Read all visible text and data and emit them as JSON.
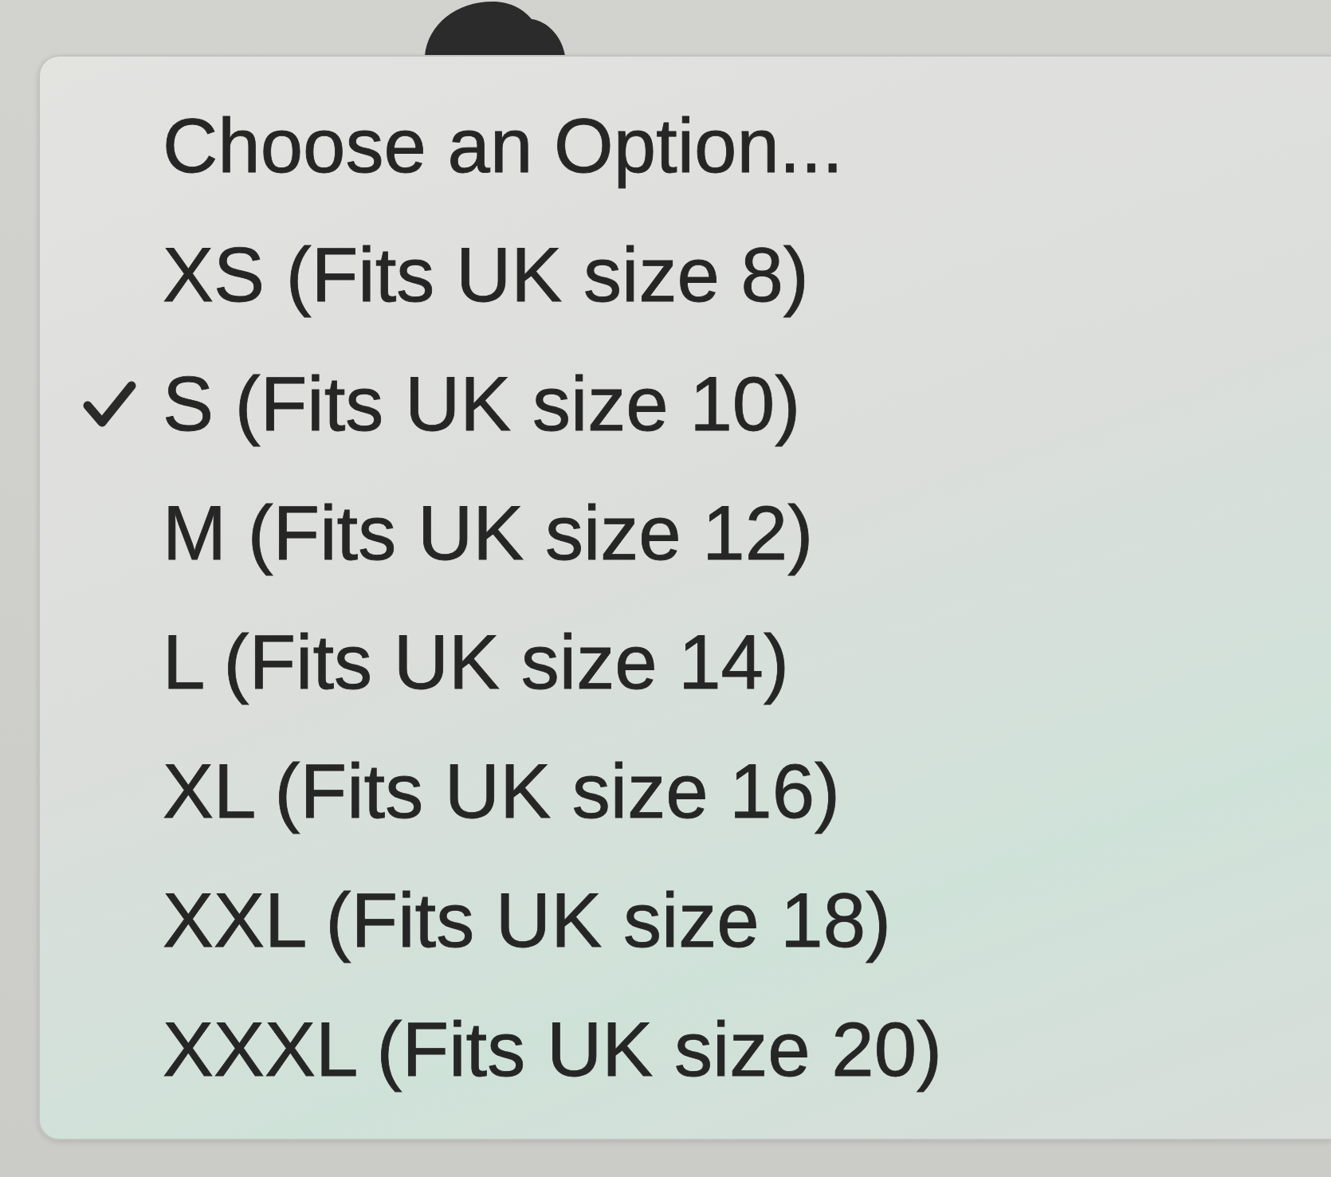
{
  "menu": {
    "items": [
      {
        "label": "Choose an Option...",
        "selected": false
      },
      {
        "label": "XS (Fits UK size 8)",
        "selected": false
      },
      {
        "label": "S (Fits UK size 10)",
        "selected": true
      },
      {
        "label": "M (Fits UK size 12)",
        "selected": false
      },
      {
        "label": "L (Fits UK size 14)",
        "selected": false
      },
      {
        "label": "XL (Fits UK size 16)",
        "selected": false
      },
      {
        "label": "XXL (Fits UK size 18)",
        "selected": false
      },
      {
        "label": "XXXL (Fits UK size 20)",
        "selected": false
      }
    ]
  }
}
